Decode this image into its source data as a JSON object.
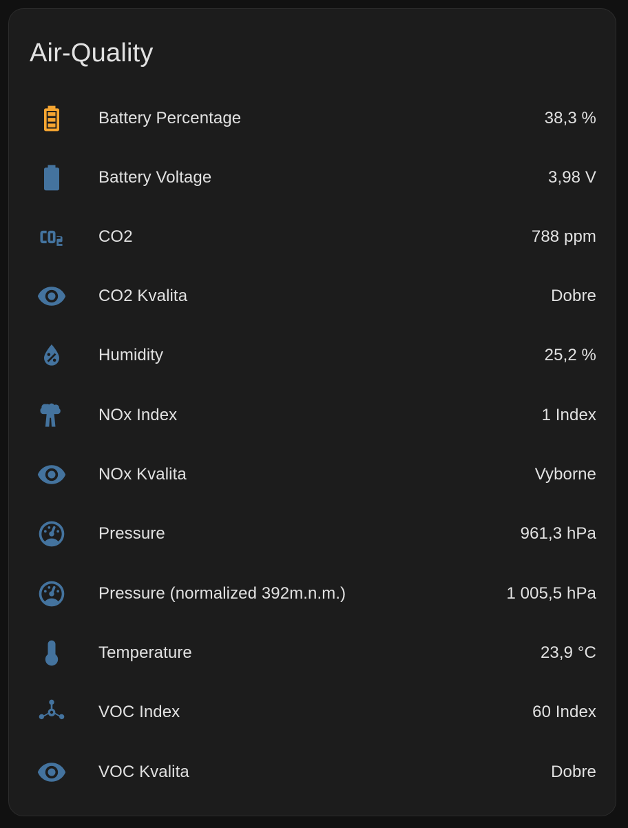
{
  "card": {
    "title": "Air-Quality"
  },
  "colors": {
    "background": "#111111",
    "card": "#1c1c1c",
    "text": "#e1e1e1",
    "icon": "#44739e",
    "battery_warning": "#f5a531"
  },
  "entities": [
    {
      "icon": "battery-40-icon",
      "name": "Battery Percentage",
      "value": "38,3 %"
    },
    {
      "icon": "battery-icon",
      "name": "Battery Voltage",
      "value": "3,98 V"
    },
    {
      "icon": "molecule-co2-icon",
      "name": "CO2",
      "value": "788 ppm"
    },
    {
      "icon": "eye-icon",
      "name": "CO2 Kvalita",
      "value": "Dobre"
    },
    {
      "icon": "water-percent-icon",
      "name": "Humidity",
      "value": "25,2 %"
    },
    {
      "icon": "smoke-stacks-icon",
      "name": "NOx Index",
      "value": "1 Index"
    },
    {
      "icon": "eye-icon",
      "name": "NOx Kvalita",
      "value": "Vyborne"
    },
    {
      "icon": "gauge-icon",
      "name": "Pressure",
      "value": "961,3 hPa"
    },
    {
      "icon": "gauge-icon",
      "name": "Pressure (normalized 392m.n.m.)",
      "value": "1 005,5 hPa"
    },
    {
      "icon": "thermometer-icon",
      "name": "Temperature",
      "value": "23,9 °C"
    },
    {
      "icon": "molecule-icon",
      "name": "VOC Index",
      "value": "60 Index"
    },
    {
      "icon": "eye-icon",
      "name": "VOC Kvalita",
      "value": "Dobre"
    }
  ]
}
